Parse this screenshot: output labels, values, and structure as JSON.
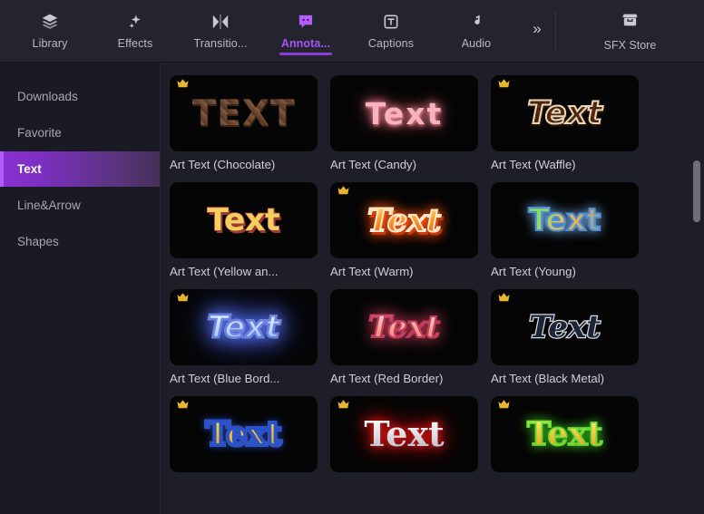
{
  "toolbar": {
    "tabs": [
      {
        "label": "Library",
        "icon": "layers-icon",
        "active": false
      },
      {
        "label": "Effects",
        "icon": "sparkle-icon",
        "active": false
      },
      {
        "label": "Transitio...",
        "icon": "transition-icon",
        "active": false
      },
      {
        "label": "Annota...",
        "icon": "annotation-icon",
        "active": true
      },
      {
        "label": "Captions",
        "icon": "caption-t-icon",
        "active": false
      },
      {
        "label": "Audio",
        "icon": "music-note-icon",
        "active": false
      }
    ],
    "overflow_icon": "chevron-double-right-icon",
    "store": {
      "label": "SFX Store",
      "icon": "store-icon"
    },
    "active_color": "#a855f7"
  },
  "sidebar": {
    "items": [
      {
        "label": "Downloads",
        "active": false
      },
      {
        "label": "Favorite",
        "active": false
      },
      {
        "label": "Text",
        "active": true
      },
      {
        "label": "Line&Arrow",
        "active": false
      },
      {
        "label": "Shapes",
        "active": false
      }
    ],
    "active_gradient_start": "#8b31d4",
    "active_gradient_end": "#463058"
  },
  "content": {
    "items": [
      {
        "caption": "Art Text (Chocolate)",
        "sample": "TEXT",
        "style": "ta-choc",
        "pro": true
      },
      {
        "caption": "Art Text (Candy)",
        "sample": "Text",
        "style": "ta-candy",
        "pro": false
      },
      {
        "caption": "Art Text (Waffle)",
        "sample": "Text",
        "style": "ta-waffle",
        "pro": true
      },
      {
        "caption": "Art Text (Yellow an...",
        "sample": "Text",
        "style": "ta-yellow",
        "pro": false
      },
      {
        "caption": "Art Text (Warm)",
        "sample": "Text",
        "style": "ta-warm",
        "pro": true
      },
      {
        "caption": "Art Text (Young)",
        "sample": "Text",
        "style": "ta-young",
        "pro": false
      },
      {
        "caption": "Art Text (Blue Bord...",
        "sample": "Text",
        "style": "ta-blue",
        "pro": true
      },
      {
        "caption": "Art Text (Red Border)",
        "sample": "Text",
        "style": "ta-red",
        "pro": false
      },
      {
        "caption": "Art Text (Black Metal)",
        "sample": "Text",
        "style": "ta-metal",
        "pro": true
      },
      {
        "caption": "",
        "sample": "Text",
        "style": "ta-goldblue",
        "pro": true
      },
      {
        "caption": "",
        "sample": "Text",
        "style": "ta-silverred",
        "pro": true
      },
      {
        "caption": "",
        "sample": "Text",
        "style": "ta-greengold",
        "pro": true
      }
    ],
    "pro_badge_icon": "crown-icon",
    "pro_badge_color": "#e8b52f"
  },
  "scrollbar": {
    "name": "vertical-scrollbar"
  }
}
